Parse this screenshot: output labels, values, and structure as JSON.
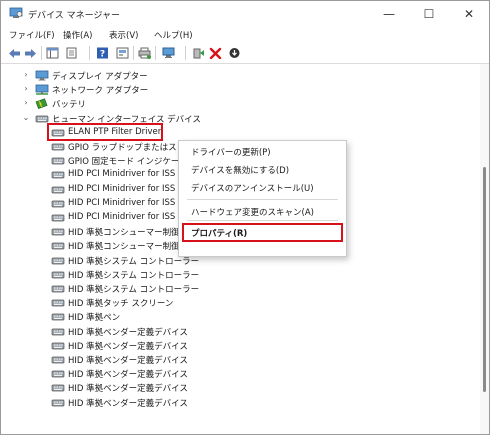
{
  "window": {
    "title": "デバイス マネージャー"
  },
  "title_buttons": [
    {
      "name": "minimize-button",
      "glyph": "—"
    },
    {
      "name": "maximize-button",
      "glyph": "☐"
    },
    {
      "name": "close-button",
      "glyph": "✕"
    }
  ],
  "menu": [
    {
      "name": "menu-file",
      "label": "ファイル(F)"
    },
    {
      "name": "menu-action",
      "label": "操作(A)"
    },
    {
      "name": "menu-view",
      "label": "表示(V)"
    },
    {
      "name": "menu-help",
      "label": "ヘルプ(H)"
    }
  ],
  "toolbar_icons": [
    "back-arrow-icon",
    "forward-arrow-icon",
    "show-hide-tree-icon",
    "properties-icon",
    "help-icon",
    "update-view-icon",
    "print-icon",
    "scan-hardware-icon",
    "add-driver-icon",
    "uninstall-icon",
    "disable-device-icon"
  ],
  "tree": [
    {
      "label": "ディスプレイ アダプター",
      "chev": "›",
      "indent": 0,
      "icon": "display-adapter-icon"
    },
    {
      "label": "ネットワーク アダプター",
      "chev": "›",
      "indent": 0,
      "icon": "network-adapter-icon"
    },
    {
      "label": "バッテリ",
      "chev": "›",
      "indent": 0,
      "icon": "battery-icon"
    },
    {
      "label": "ヒューマン インターフェイス デバイス",
      "chev": "⌄",
      "indent": 0,
      "icon": "hid-category-icon"
    },
    {
      "label": "ELAN PTP Filter Driver",
      "chev": "",
      "indent": 1,
      "icon": "hid-device-icon",
      "selected": true
    },
    {
      "label": "GPIO ラップドップまたはスレート インジケーター",
      "chev": "",
      "indent": 1,
      "icon": "hid-device-icon"
    },
    {
      "label": "GPIO 固定モード インジケーター",
      "chev": "",
      "indent": 1,
      "icon": "hid-device-icon"
    },
    {
      "label": "HID PCI Minidriver for ISS",
      "chev": "",
      "indent": 1,
      "icon": "hid-device-icon"
    },
    {
      "label": "HID PCI Minidriver for ISS",
      "chev": "",
      "indent": 1,
      "icon": "hid-device-icon"
    },
    {
      "label": "HID PCI Minidriver for ISS",
      "chev": "",
      "indent": 1,
      "icon": "hid-device-icon"
    },
    {
      "label": "HID PCI Minidriver for ISS",
      "chev": "",
      "indent": 1,
      "icon": "hid-device-icon"
    },
    {
      "label": "HID 準拠コンシューマー制御デバイス",
      "chev": "",
      "indent": 1,
      "icon": "hid-device-icon"
    },
    {
      "label": "HID 準拠コンシューマー制御デバイス",
      "chev": "",
      "indent": 1,
      "icon": "hid-device-icon"
    },
    {
      "label": "HID 準拠システム コントローラー",
      "chev": "",
      "indent": 1,
      "icon": "hid-device-icon"
    },
    {
      "label": "HID 準拠システム コントローラー",
      "chev": "",
      "indent": 1,
      "icon": "hid-device-icon"
    },
    {
      "label": "HID 準拠システム コントローラー",
      "chev": "",
      "indent": 1,
      "icon": "hid-device-icon"
    },
    {
      "label": "HID 準拠タッチ スクリーン",
      "chev": "",
      "indent": 1,
      "icon": "hid-device-icon"
    },
    {
      "label": "HID 準拠ペン",
      "chev": "",
      "indent": 1,
      "icon": "hid-device-icon"
    },
    {
      "label": "HID 準拠ベンダー定義デバイス",
      "chev": "",
      "indent": 1,
      "icon": "hid-device-icon"
    },
    {
      "label": "HID 準拠ベンダー定義デバイス",
      "chev": "",
      "indent": 1,
      "icon": "hid-device-icon"
    },
    {
      "label": "HID 準拠ベンダー定義デバイス",
      "chev": "",
      "indent": 1,
      "icon": "hid-device-icon"
    },
    {
      "label": "HID 準拠ベンダー定義デバイス",
      "chev": "",
      "indent": 1,
      "icon": "hid-device-icon"
    },
    {
      "label": "HID 準拠ベンダー定義デバイス",
      "chev": "",
      "indent": 1,
      "icon": "hid-device-icon"
    },
    {
      "label": "HID 準拠ベンダー定義デバイス",
      "chev": "",
      "indent": 1,
      "icon": "hid-device-icon"
    }
  ],
  "context_menu": {
    "items": [
      {
        "name": "ctx-update-driver",
        "label": "ドライバーの更新(P)"
      },
      {
        "name": "ctx-disable-device",
        "label": "デバイスを無効にする(D)"
      },
      {
        "name": "ctx-uninstall-device",
        "label": "デバイスのアンインストール(U)"
      },
      {
        "name": "ctx-scan-hardware",
        "label": "ハードウェア変更のスキャン(A)"
      },
      {
        "name": "ctx-properties",
        "label": "プロパティ(R)",
        "bold": true
      }
    ]
  },
  "colors": {
    "highlight_red": "#d8121b",
    "accent_blue": "#1e6fc7"
  }
}
